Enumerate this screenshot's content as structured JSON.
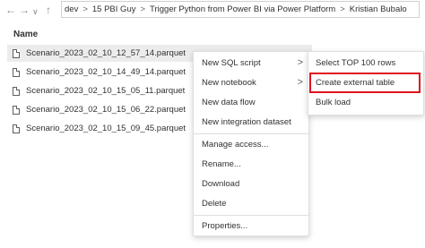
{
  "nav": {
    "back_icon": "arrow-left-icon",
    "forward_icon": "arrow-right-icon",
    "dropdown_icon": "chevron-down-icon",
    "up_icon": "arrow-up-icon",
    "breadcrumbs": [
      "dev",
      "15 PBI Guy",
      "Trigger Python from Power BI via Power Platform",
      "Kristian Bubalo"
    ],
    "separator": ">"
  },
  "list": {
    "column_header": "Name",
    "files": [
      "Scenario_2023_02_10_12_57_14.parquet",
      "Scenario_2023_02_10_14_49_14.parquet",
      "Scenario_2023_02_10_15_05_11.parquet",
      "Scenario_2023_02_10_15_06_22.parquet",
      "Scenario_2023_02_10_15_09_45.parquet"
    ]
  },
  "context_menu": {
    "items": [
      {
        "label": "New SQL script",
        "has_submenu": true
      },
      {
        "label": "New notebook",
        "has_submenu": true
      },
      {
        "label": "New data flow",
        "has_submenu": false
      },
      {
        "label": "New integration dataset",
        "has_submenu": false
      },
      {
        "label": "Manage access...",
        "has_submenu": false
      },
      {
        "label": "Rename...",
        "has_submenu": false
      },
      {
        "label": "Download",
        "has_submenu": false
      },
      {
        "label": "Delete",
        "has_submenu": false
      },
      {
        "label": "Properties...",
        "has_submenu": false
      }
    ],
    "chevron": ">"
  },
  "submenu": {
    "items": [
      "Select TOP 100 rows",
      "Create external table",
      "Bulk load"
    ],
    "highlight_color": "#e0131d"
  }
}
